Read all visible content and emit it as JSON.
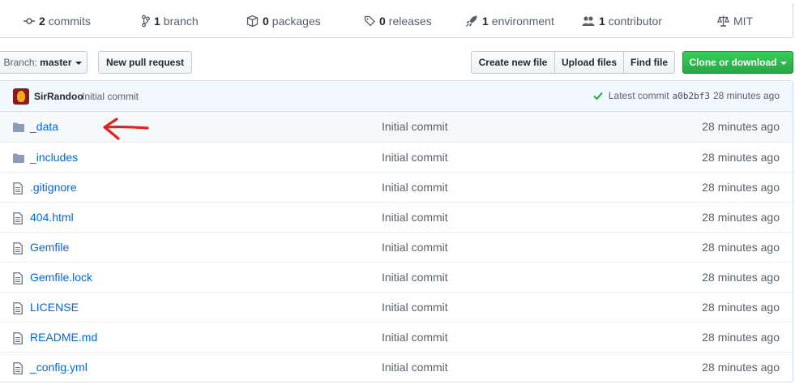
{
  "summary": {
    "commits": {
      "count": "2",
      "label": "commits"
    },
    "branches": {
      "count": "1",
      "label": "branch"
    },
    "packages": {
      "count": "0",
      "label": "packages"
    },
    "releases": {
      "count": "0",
      "label": "releases"
    },
    "environments": {
      "count": "1",
      "label": "environment"
    },
    "contributors": {
      "count": "1",
      "label": "contributor"
    },
    "license": {
      "label": "MIT"
    }
  },
  "toolbar": {
    "branch_prefix": "Branch:",
    "branch_name": "master",
    "new_pull_request": "New pull request",
    "create_new_file": "Create new file",
    "upload_files": "Upload files",
    "find_file": "Find file",
    "clone_or_download": "Clone or download"
  },
  "latest_commit": {
    "author": "SirRandoo",
    "message": "Initial commit",
    "prefix": "Latest commit",
    "sha": "a0b2bf3",
    "age": "28 minutes ago"
  },
  "files": [
    {
      "type": "dir",
      "icon": "folder-icon",
      "name": "_data",
      "message": "Initial commit",
      "age": "28 minutes ago"
    },
    {
      "type": "dir",
      "icon": "folder-icon",
      "name": "_includes",
      "message": "Initial commit",
      "age": "28 minutes ago"
    },
    {
      "type": "file",
      "icon": "file-icon",
      "name": ".gitignore",
      "message": "Initial commit",
      "age": "28 minutes ago"
    },
    {
      "type": "file",
      "icon": "file-icon",
      "name": "404.html",
      "message": "Initial commit",
      "age": "28 minutes ago"
    },
    {
      "type": "file",
      "icon": "file-icon",
      "name": "Gemfile",
      "message": "Initial commit",
      "age": "28 minutes ago"
    },
    {
      "type": "file",
      "icon": "file-icon",
      "name": "Gemfile.lock",
      "message": "Initial commit",
      "age": "28 minutes ago"
    },
    {
      "type": "file",
      "icon": "file-icon",
      "name": "LICENSE",
      "message": "Initial commit",
      "age": "28 minutes ago"
    },
    {
      "type": "file",
      "icon": "file-icon",
      "name": "README.md",
      "message": "Initial commit",
      "age": "28 minutes ago"
    },
    {
      "type": "file",
      "icon": "file-icon",
      "name": "_config.yml",
      "message": "Initial commit",
      "age": "28 minutes ago"
    }
  ],
  "colors": {
    "link": "#0366d6",
    "muted": "#586069",
    "commit_bar_bg": "#f1f8ff",
    "clone_button": "#28a745",
    "annotation_arrow": "#e0211d"
  }
}
